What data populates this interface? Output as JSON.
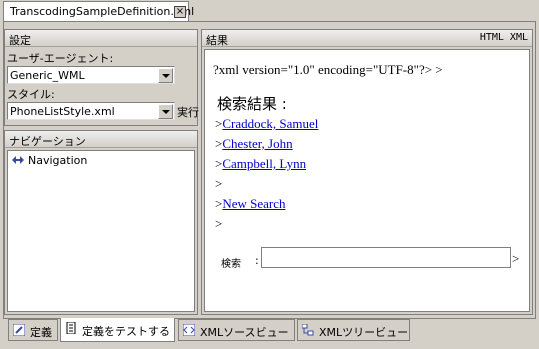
{
  "editor": {
    "tab_title": "TranscodingSampleDefinition.xml",
    "close_glyph": "×"
  },
  "settings": {
    "title": "設定",
    "user_agent_label": "ユーザ-エージェント:",
    "user_agent_value": "Generic_WML",
    "style_label": "スタイル:",
    "style_value": "PhoneListStyle.xml",
    "run_label": "実行"
  },
  "navigation": {
    "title": "ナビゲーション",
    "tree_item": "Navigation"
  },
  "result": {
    "title": "結果",
    "mode": "HTML XML",
    "xml_decl": "?xml version=\"1.0\" encoding=\"UTF-8\"?> >",
    "heading": "検索結果 :",
    "lines": [
      {
        "prefix": ">",
        "link": "Craddock, Samuel"
      },
      {
        "prefix": ">",
        "link": "Chester, John"
      },
      {
        "prefix": ">",
        "link": "Campbell, Lynn"
      },
      {
        "prefix": ">",
        "link": ""
      },
      {
        "prefix": ">",
        "link": "New Search"
      },
      {
        "prefix": ">",
        "link": ""
      }
    ],
    "search_label": "検索",
    "search_colon": ":",
    "search_value": "",
    "search_suffix": ">"
  },
  "bottom_tabs": [
    {
      "label": "定義",
      "icon": "pen-icon"
    },
    {
      "label": "定義をテストする",
      "icon": "document-icon"
    },
    {
      "label": "XMLソースビュー",
      "icon": "xml-source-icon"
    },
    {
      "label": "XMLツリービュー",
      "icon": "tree-icon"
    }
  ]
}
